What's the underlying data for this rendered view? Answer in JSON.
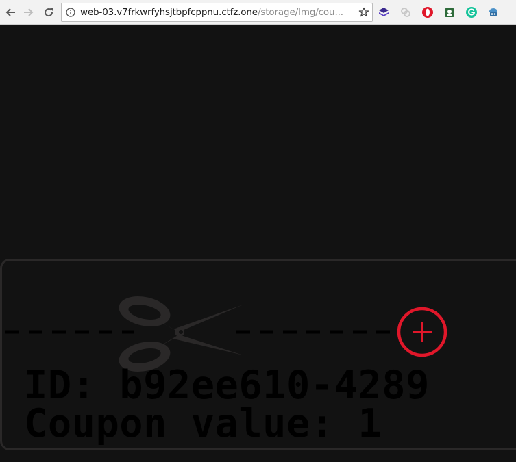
{
  "browser": {
    "url_host": "web-03.v7frkwrfyhsjtbpfcppnu.ctfz.one",
    "url_path": "/storage/Img/cou...",
    "icons": {
      "back": "arrow-left-icon",
      "forward": "arrow-right-icon",
      "reload": "reload-icon",
      "info": "info-icon",
      "bookmark": "star-icon"
    },
    "extensions": [
      "stack-extension-icon",
      "links-extension-icon",
      "opera-extension-icon",
      "puzzle-extension-icon",
      "grammarly-extension-icon",
      "robot-extension-icon"
    ]
  },
  "coupon": {
    "id_line": "ID: b92ee610-4289",
    "value_line": "Coupon value: 1",
    "accent_color": "#e0172a",
    "scissors_color": "#2a2828"
  }
}
